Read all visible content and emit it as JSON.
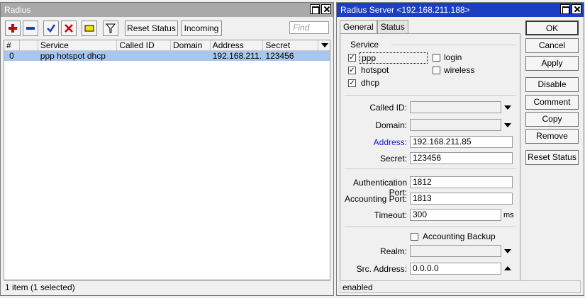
{
  "left_window": {
    "title": "Radius",
    "toolbar": {
      "reset_status": "Reset Status",
      "incoming": "Incoming",
      "find_placeholder": "Find"
    },
    "table": {
      "headers": [
        "#",
        "",
        "Service",
        "Called ID",
        "Domain",
        "Address",
        "Secret"
      ],
      "rows": [
        {
          "num": "0",
          "flag": "",
          "service": "ppp hotspot dhcp",
          "called_id": "",
          "domain": "",
          "address": "192.168.211....",
          "secret": "123456"
        }
      ]
    },
    "status": "1 item (1 selected)"
  },
  "right_window": {
    "title": "Radius Server <192.168.211.188>",
    "tabs": [
      "General",
      "Status"
    ],
    "service_group": {
      "legend": "Service",
      "items": [
        {
          "label": "ppp",
          "checked": true
        },
        {
          "label": "login",
          "checked": false
        },
        {
          "label": "hotspot",
          "checked": true
        },
        {
          "label": "wireless",
          "checked": false
        },
        {
          "label": "dhcp",
          "checked": true
        }
      ]
    },
    "fields": {
      "called_id": {
        "label": "Called ID:",
        "value": ""
      },
      "domain": {
        "label": "Domain:",
        "value": ""
      },
      "address": {
        "label": "Address:",
        "value": "192.168.211.85"
      },
      "secret": {
        "label": "Secret:",
        "value": "123456"
      },
      "auth_port": {
        "label": "Authentication Port:",
        "value": "1812"
      },
      "acct_port": {
        "label": "Accounting Port:",
        "value": "1813"
      },
      "timeout": {
        "label": "Timeout:",
        "value": "300",
        "unit": "ms"
      },
      "acct_backup": {
        "label": "Accounting Backup",
        "checked": false
      },
      "realm": {
        "label": "Realm:",
        "value": ""
      },
      "src_address": {
        "label": "Src. Address:",
        "value": "0.0.0.0"
      }
    },
    "buttons": {
      "ok": "OK",
      "cancel": "Cancel",
      "apply": "Apply",
      "disable": "Disable",
      "comment": "Comment",
      "copy": "Copy",
      "remove": "Remove",
      "reset_status": "Reset Status"
    },
    "status": "enabled"
  },
  "colors": {
    "active_title": "#1c3fc2",
    "inactive_title": "#a9a9a9",
    "selected_row": "#a9c6ee",
    "address_label": "#1a1acc",
    "add_icon": "#cc0000",
    "check_icon": "#1a3fb0"
  }
}
